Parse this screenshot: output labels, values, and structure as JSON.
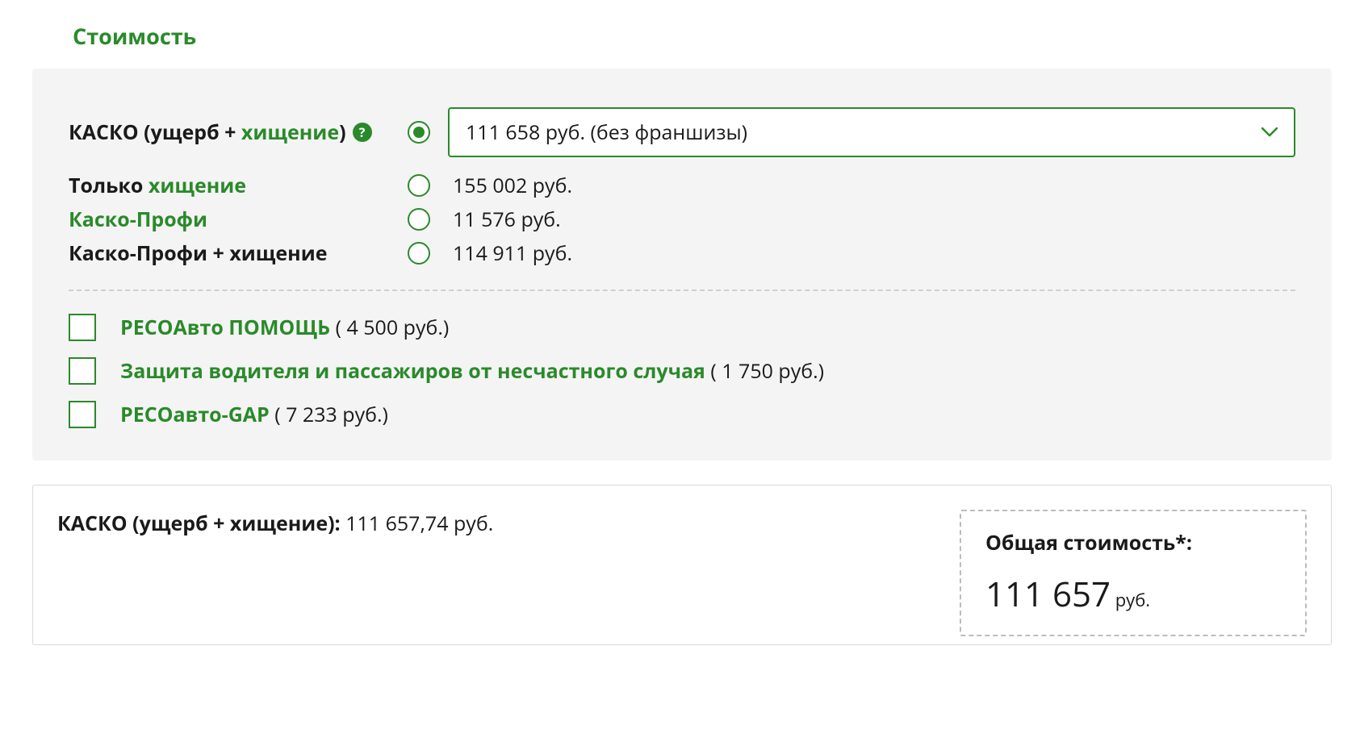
{
  "title": "Стоимость",
  "options": {
    "kasko_full": {
      "label_prefix": "КАСКО (ущерб + ",
      "label_green": "хищение",
      "label_suffix": ")",
      "help_text": "?",
      "select_value": "111 658 руб. (без франшизы)"
    },
    "only_theft": {
      "label_prefix": "Только ",
      "label_green": "хищение",
      "price": "155 002 руб."
    },
    "kasko_profi": {
      "label": "Каско-Профи",
      "price": "11 576 руб."
    },
    "kasko_profi_theft": {
      "label": "Каско-Профи + хищение",
      "price": "114 911 руб."
    }
  },
  "addons": {
    "reso_help": {
      "name": "РЕСОАвто ПОМОЩЬ",
      "price": "( 4 500 руб.)"
    },
    "passenger_protect": {
      "name": "Защита водителя и пассажиров от несчастного случая",
      "price": "( 1 750 руб.)"
    },
    "reso_gap": {
      "name": "РЕСОавто-GAP",
      "price": "( 7 233 руб.)"
    }
  },
  "summary": {
    "line_label": "КАСКО (ущерб + хищение): ",
    "line_value": "111 657,74 руб.",
    "total_label": "Общая стоимость*:",
    "total_value": "111 657",
    "total_unit": " руб."
  }
}
